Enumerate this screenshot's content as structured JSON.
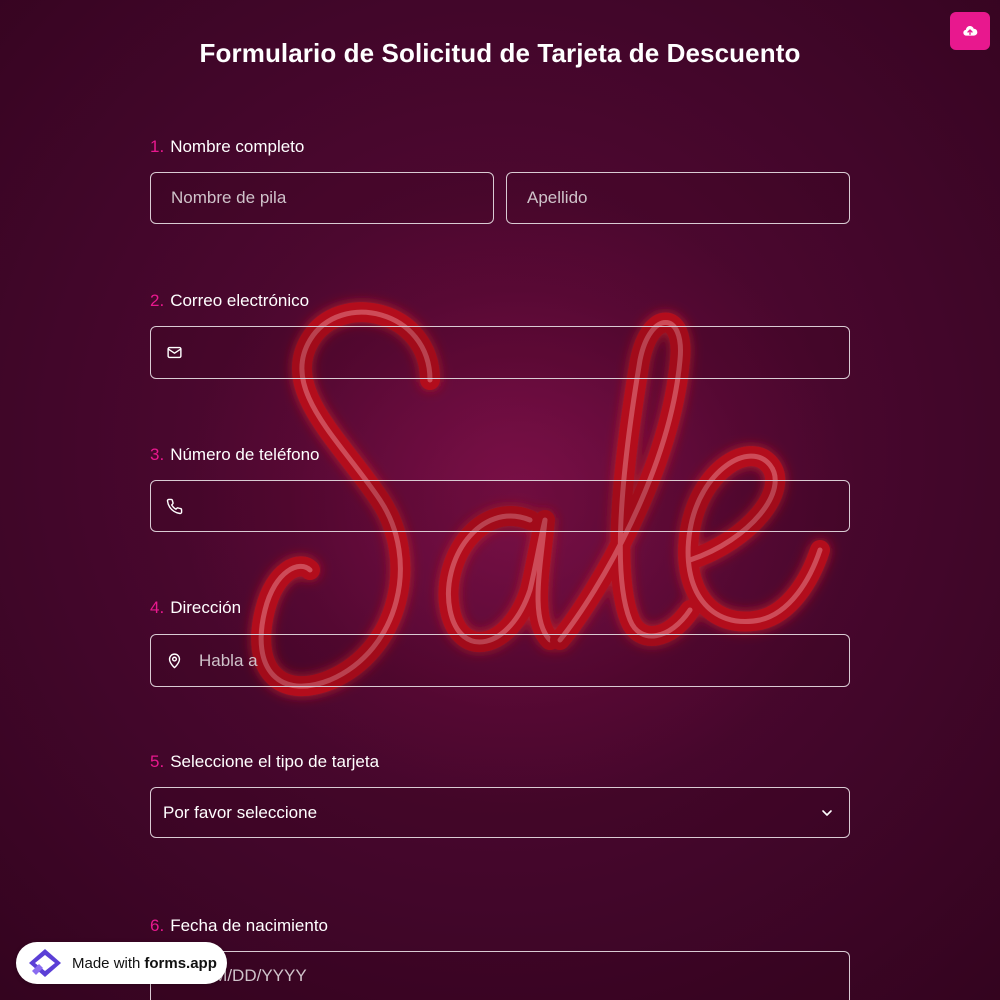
{
  "header": {
    "title": "Formulario de Solicitud de Tarjeta de Descuento",
    "upload_icon": "cloud-upload-icon"
  },
  "colors": {
    "accent": "#e8188e",
    "background": "#3a0524",
    "field_border": "#d9cbd3"
  },
  "questions": [
    {
      "number": "1.",
      "label": "Nombre completo",
      "first_name_placeholder": "Nombre de pila",
      "last_name_placeholder": "Apellido"
    },
    {
      "number": "2.",
      "label": "Correo electrónico",
      "icon": "mail-icon",
      "value": ""
    },
    {
      "number": "3.",
      "label": "Número de teléfono",
      "icon": "phone-icon",
      "value": ""
    },
    {
      "number": "4.",
      "label": "Dirección",
      "icon": "location-pin-icon",
      "placeholder": "Habla a"
    },
    {
      "number": "5.",
      "label": "Seleccione el tipo de tarjeta",
      "selected": "Por favor seleccione",
      "icon": "chevron-down-icon"
    },
    {
      "number": "6.",
      "label": "Fecha de nacimiento",
      "placeholder": "MM/DD/YYYY",
      "icon": "calendar-icon"
    }
  ],
  "badge": {
    "prefix": "Made with",
    "brand": "forms.app",
    "icon": "forms-app-logo-icon"
  }
}
